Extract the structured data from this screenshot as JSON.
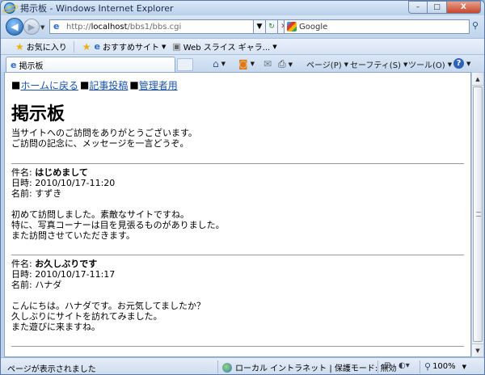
{
  "window": {
    "title": "掲示板 - Windows Internet Explorer",
    "min": "–",
    "max": "□",
    "close": "X"
  },
  "address": {
    "url_prefix": "http://",
    "url_host": "localhost",
    "url_path": "/bbs1/bbs.cgi",
    "search_placeholder": "Google"
  },
  "favorites": {
    "label": "お気に入り",
    "items": [
      "おすすめサイト",
      "Web スライス ギャラ..."
    ]
  },
  "tab": {
    "title": "掲示板"
  },
  "commands": {
    "page": "ページ(P)",
    "safety": "セーフティ(S)",
    "tools": "ツール(O)"
  },
  "page": {
    "links": [
      "ホームに戻る",
      "記事投稿",
      "管理者用"
    ],
    "link_marker": "■",
    "title": "掲示板",
    "intro": [
      "当サイトへのご訪問をありがとうございます。",
      "ご訪問の記念に、メッセージを一言どうぞ。"
    ],
    "posts": [
      {
        "subject_label": "件名:",
        "subject": "はじめまして",
        "date_label": "日時:",
        "date": "2010/10/17-11:20",
        "name_label": "名前:",
        "name": "すずき",
        "body": [
          "初めて訪問しました。素敵なサイトですね。",
          "特に、写真コーナーは目を見張るものがありました。",
          "また訪問させていただきます。"
        ]
      },
      {
        "subject_label": "件名:",
        "subject": "お久しぶりです",
        "date_label": "日時:",
        "date": "2010/10/17-11:17",
        "name_label": "名前:",
        "name": "ハナダ",
        "body": [
          "こんにちは。ハナダです。お元気してましたか？",
          "久しぶりにサイトを訪れてみました。",
          "また遊びに来ますね。"
        ]
      }
    ]
  },
  "status": {
    "left": "ページが表示されました",
    "zone": "ローカル イントラネット | 保護モード: 無効",
    "zoom": "100%"
  }
}
